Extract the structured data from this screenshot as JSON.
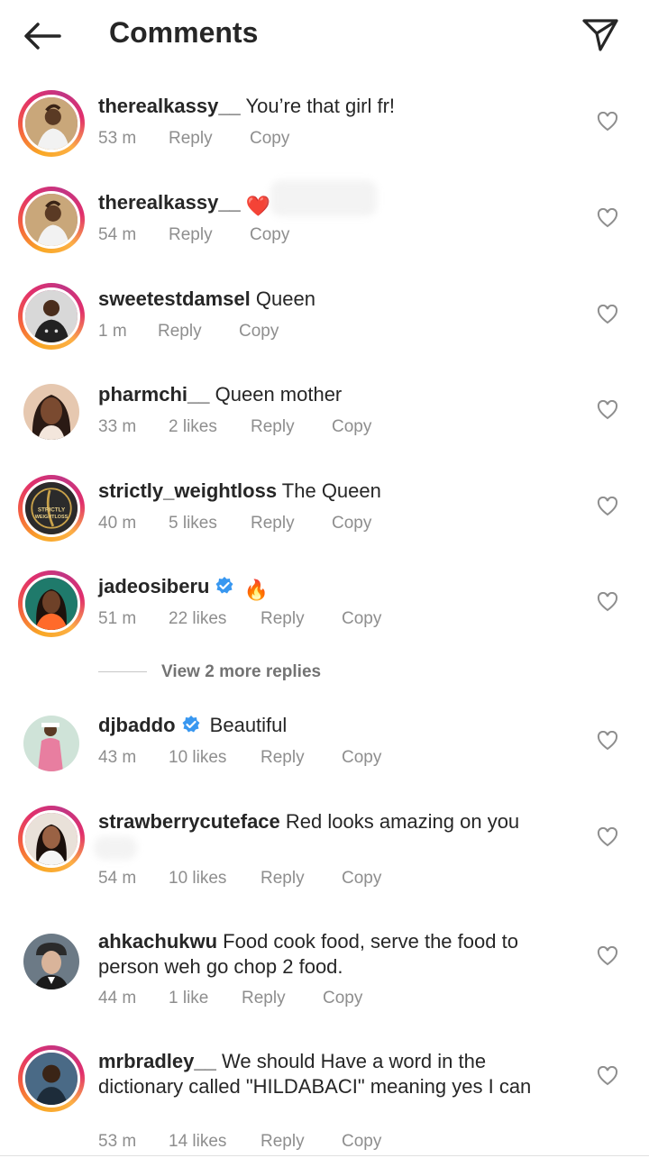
{
  "header": {
    "title": "Comments",
    "back_icon": "arrow-left-icon",
    "share_icon": "paper-plane-icon"
  },
  "actions": {
    "reply": "Reply",
    "copy": "Copy"
  },
  "comments": [
    {
      "username": "therealkassy__",
      "text": "You’re that girl fr!",
      "time": "53 m",
      "likes": ""
    },
    {
      "username": "therealkassy__",
      "text": "",
      "emoji": "❤️",
      "time": "54 m",
      "likes": ""
    },
    {
      "username": "sweetestdamsel",
      "text": "Queen",
      "time": "1 m",
      "likes": ""
    },
    {
      "username": "pharmchi__",
      "text": "Queen mother",
      "time": "33 m",
      "likes": "2 likes"
    },
    {
      "username": "strictly_weightloss",
      "text": "The Queen",
      "time": "40 m",
      "likes": "5 likes",
      "avatar_text": "STRICTLY WEIGHTLOSS"
    },
    {
      "username": "jadeosiberu",
      "text": "",
      "emoji": "🔥",
      "verified": true,
      "time": "51 m",
      "likes": "22 likes"
    },
    {
      "username": "djbaddo",
      "text": "Beautiful",
      "verified": true,
      "time": "43 m",
      "likes": "10 likes"
    },
    {
      "username": "strawberrycuteface",
      "text": "Red looks amazing on you",
      "time": "54 m",
      "likes": "10 likes"
    },
    {
      "username": "ahkachukwu",
      "text": "Food cook food, serve the food to person weh go chop 2 food.",
      "time": "44 m",
      "likes": "1 like"
    },
    {
      "username": "mrbradley__",
      "text": "We should Have a word in the dictionary called \"HILDABACI\" meaning yes I can",
      "time": "53 m",
      "likes": "14 likes"
    }
  ],
  "view_replies": "View 2 more replies",
  "colors": {
    "accent_verified": "#3897f0",
    "heart_red": "#ed1c24",
    "fire": "#ff6a00",
    "meta_gray": "#8e8e8e"
  }
}
